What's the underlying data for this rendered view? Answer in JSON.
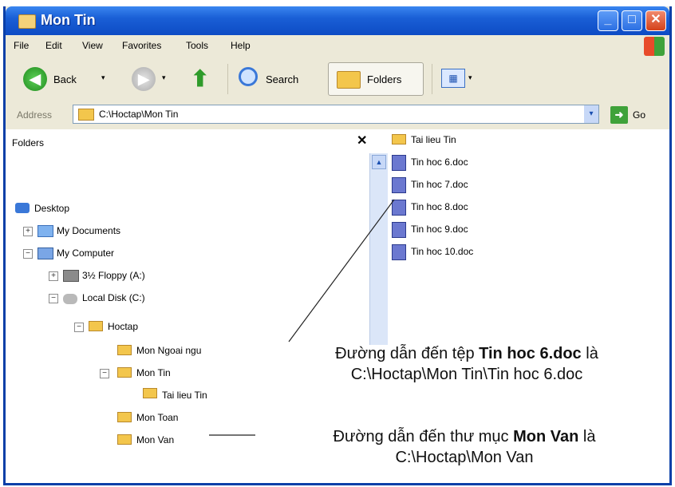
{
  "window": {
    "title": "Mon Tin",
    "min_glyph": "_",
    "max_glyph": "□",
    "close_glyph": "✕"
  },
  "menu": [
    "File",
    "Edit",
    "View",
    "Favorites",
    "Tools",
    "Help"
  ],
  "toolbar": {
    "back": "Back",
    "search": "Search",
    "folders": "Folders",
    "back_glyph": "◀",
    "fwd_glyph": "▶",
    "up_glyph": "⬆",
    "dropdown_glyph": "▾",
    "views_glyph": "▦"
  },
  "address": {
    "label": "Address",
    "path": "C:\\Hoctap\\Mon Tin",
    "go": "Go",
    "go_glyph": "➜",
    "drop_glyph": "▾"
  },
  "folders_pane": {
    "header": "Folders",
    "close_glyph": "✕",
    "tree": [
      {
        "label": "Desktop",
        "expander": ""
      },
      {
        "label": "My Documents",
        "expander": "+"
      },
      {
        "label": "My Computer",
        "expander": "−"
      },
      {
        "label": "3½ Floppy (A:)",
        "expander": "+"
      },
      {
        "label": "Local Disk (C:)",
        "expander": "−"
      },
      {
        "label": "Hoctap",
        "expander": "−"
      },
      {
        "label": "Mon Ngoai ngu",
        "expander": ""
      },
      {
        "label": "Mon Tin",
        "expander": "−"
      },
      {
        "label": "Tai lieu Tin",
        "expander": ""
      },
      {
        "label": "Mon Toan",
        "expander": ""
      },
      {
        "label": "Mon Van",
        "expander": ""
      }
    ],
    "scroll_up_glyph": "▲"
  },
  "files": [
    "Tai lieu Tin",
    "Tin hoc 6.doc",
    "Tin hoc 7.doc",
    "Tin hoc 8.doc",
    "Tin hoc 9.doc",
    "Tin hoc 10.doc"
  ],
  "annotations": {
    "file_path_prefix": "Đường dẫn đến tệp ",
    "file_name": "Tin hoc 6.doc",
    "file_path_suffix": " là",
    "file_path": "C:\\Hoctap\\Mon Tin\\Tin hoc 6.doc",
    "folder_path_prefix": "Đường dẫn đến thư mục ",
    "folder_name": "Mon Van",
    "folder_path_suffix": " là",
    "folder_path": "C:\\Hoctap\\Mon Van"
  }
}
